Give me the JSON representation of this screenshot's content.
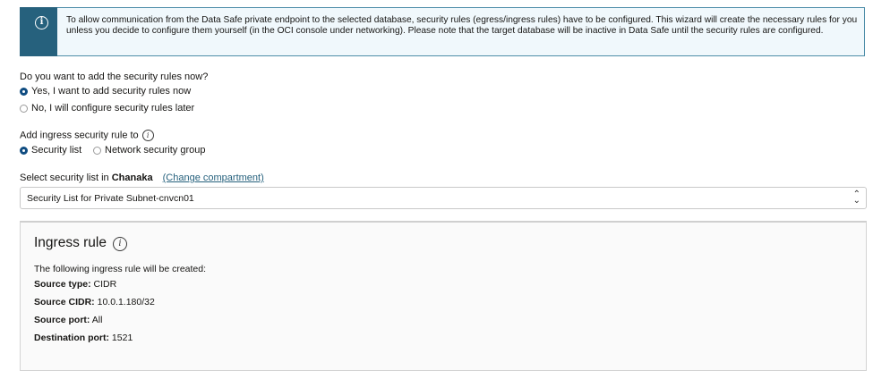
{
  "info": {
    "text": "To allow communication from the Data Safe private endpoint to the selected database, security rules (egress/ingress rules) have to be configured. This wizard will create the necessary rules for you unless you decide to configure them yourself (in the OCI console under networking). Please note that the target database will be inactive in Data Safe until the security rules are configured."
  },
  "add_rules": {
    "question": "Do you want to add the security rules now?",
    "options": [
      {
        "label": "Yes, I want to add security rules now",
        "selected": true
      },
      {
        "label": "No, I will configure security rules later",
        "selected": false
      }
    ]
  },
  "ingress_target": {
    "label": "Add ingress security rule to",
    "options": [
      {
        "label": "Security list",
        "selected": true
      },
      {
        "label": "Network security group",
        "selected": false
      }
    ]
  },
  "security_list": {
    "label_prefix": "Select security list in",
    "compartment": "Chanaka",
    "change_link": "(Change compartment)",
    "selected": "Security List for Private Subnet-cnvcn01"
  },
  "ingress_rule": {
    "title": "Ingress rule",
    "intro": "The following ingress rule will be created:",
    "fields": [
      {
        "label": "Source type:",
        "value": "CIDR"
      },
      {
        "label": "Source CIDR:",
        "value": "10.0.1.180/32"
      },
      {
        "label": "Source port:",
        "value": "All"
      },
      {
        "label": "Destination port:",
        "value": "1521"
      }
    ]
  }
}
